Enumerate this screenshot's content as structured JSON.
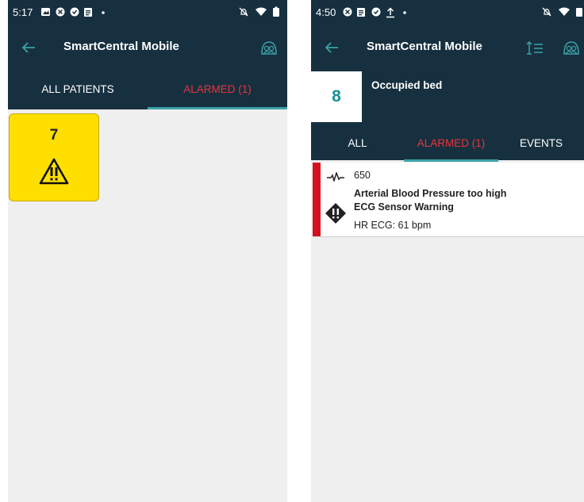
{
  "colors": {
    "header": "#17303f",
    "alarm": "#e8333c",
    "accent": "#3aa3a8",
    "tile": "#ffdf00"
  },
  "left": {
    "status": {
      "time": "5:17",
      "icons": [
        "image-icon",
        "x-circle-icon",
        "check-circle-icon",
        "clipboard-icon",
        "dot-icon"
      ],
      "right_icons": [
        "alarm-off-icon",
        "wifi-icon",
        "battery-icon"
      ]
    },
    "title": "SmartCentral Mobile",
    "tabs": [
      "ALL PATIENTS",
      "ALARMED (1)"
    ],
    "active_tab": 1,
    "tiles": [
      {
        "bed": "7",
        "icon": "warning-icon"
      }
    ]
  },
  "right": {
    "status": {
      "time": "4:50",
      "icons": [
        "x-circle-icon",
        "clipboard-icon",
        "check-circle-icon",
        "upload-icon",
        "dot-icon"
      ],
      "right_icons": [
        "alarm-off-icon",
        "wifi-icon",
        "battery-icon"
      ]
    },
    "title": "SmartCentral Mobile",
    "bed": "8",
    "bed_status": "Occupied bed",
    "tabs": [
      "ALL",
      "ALARMED (1)",
      "EVENTS"
    ],
    "active_tab": 1,
    "alarm": {
      "patient_id": "650",
      "lines": [
        "Arterial Blood Pressure too high",
        "ECG Sensor Warning"
      ],
      "vital": "HR ECG: 61 bpm"
    }
  }
}
